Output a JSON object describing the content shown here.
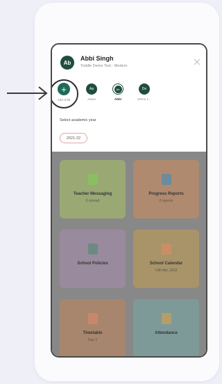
{
  "profile": {
    "initials": "Ab",
    "name": "Abbi Singh",
    "school": "Toddle Demo Test - Modern"
  },
  "children": [
    {
      "label": "Add child",
      "type": "add"
    },
    {
      "label": "Aarav",
      "initials": "Aa"
    },
    {
      "label": "Abbi",
      "initials": "Ab",
      "selected": true
    },
    {
      "label": "Demo 1...",
      "initials": "De"
    }
  ],
  "academic_year": {
    "label": "Select academic year",
    "value": "2021-22"
  },
  "tiles": [
    {
      "title": "Teacher Messaging",
      "subtitle": "0 unread",
      "color": "#9aa874",
      "icon_color": "#8bbd62",
      "icon": "chat-icon"
    },
    {
      "title": "Progress Reports",
      "subtitle": "0 reports",
      "color": "#b08a6e",
      "icon_color": "#6d8a9e",
      "icon": "report-icon"
    },
    {
      "title": "School Policies",
      "subtitle": "",
      "color": "#9a8a9e",
      "icon_color": "#6c8a84",
      "icon": "policy-icon"
    },
    {
      "title": "School Calendar",
      "subtitle": "13th Apr, 2022",
      "color": "#a89468",
      "icon_color": "#c88f67",
      "icon": "calendar-icon"
    },
    {
      "title": "Timetable",
      "subtitle": "Day 3",
      "color": "#a8866e",
      "icon_color": "#c9876a",
      "icon": "timetable-icon"
    },
    {
      "title": "Attendance",
      "subtitle": "",
      "color": "#7e9a98",
      "icon_color": "#b39e6a",
      "icon": "attendance-icon"
    }
  ],
  "colors": {
    "brand_green": "#1f4d3f",
    "dim_overlay": "#888888"
  }
}
